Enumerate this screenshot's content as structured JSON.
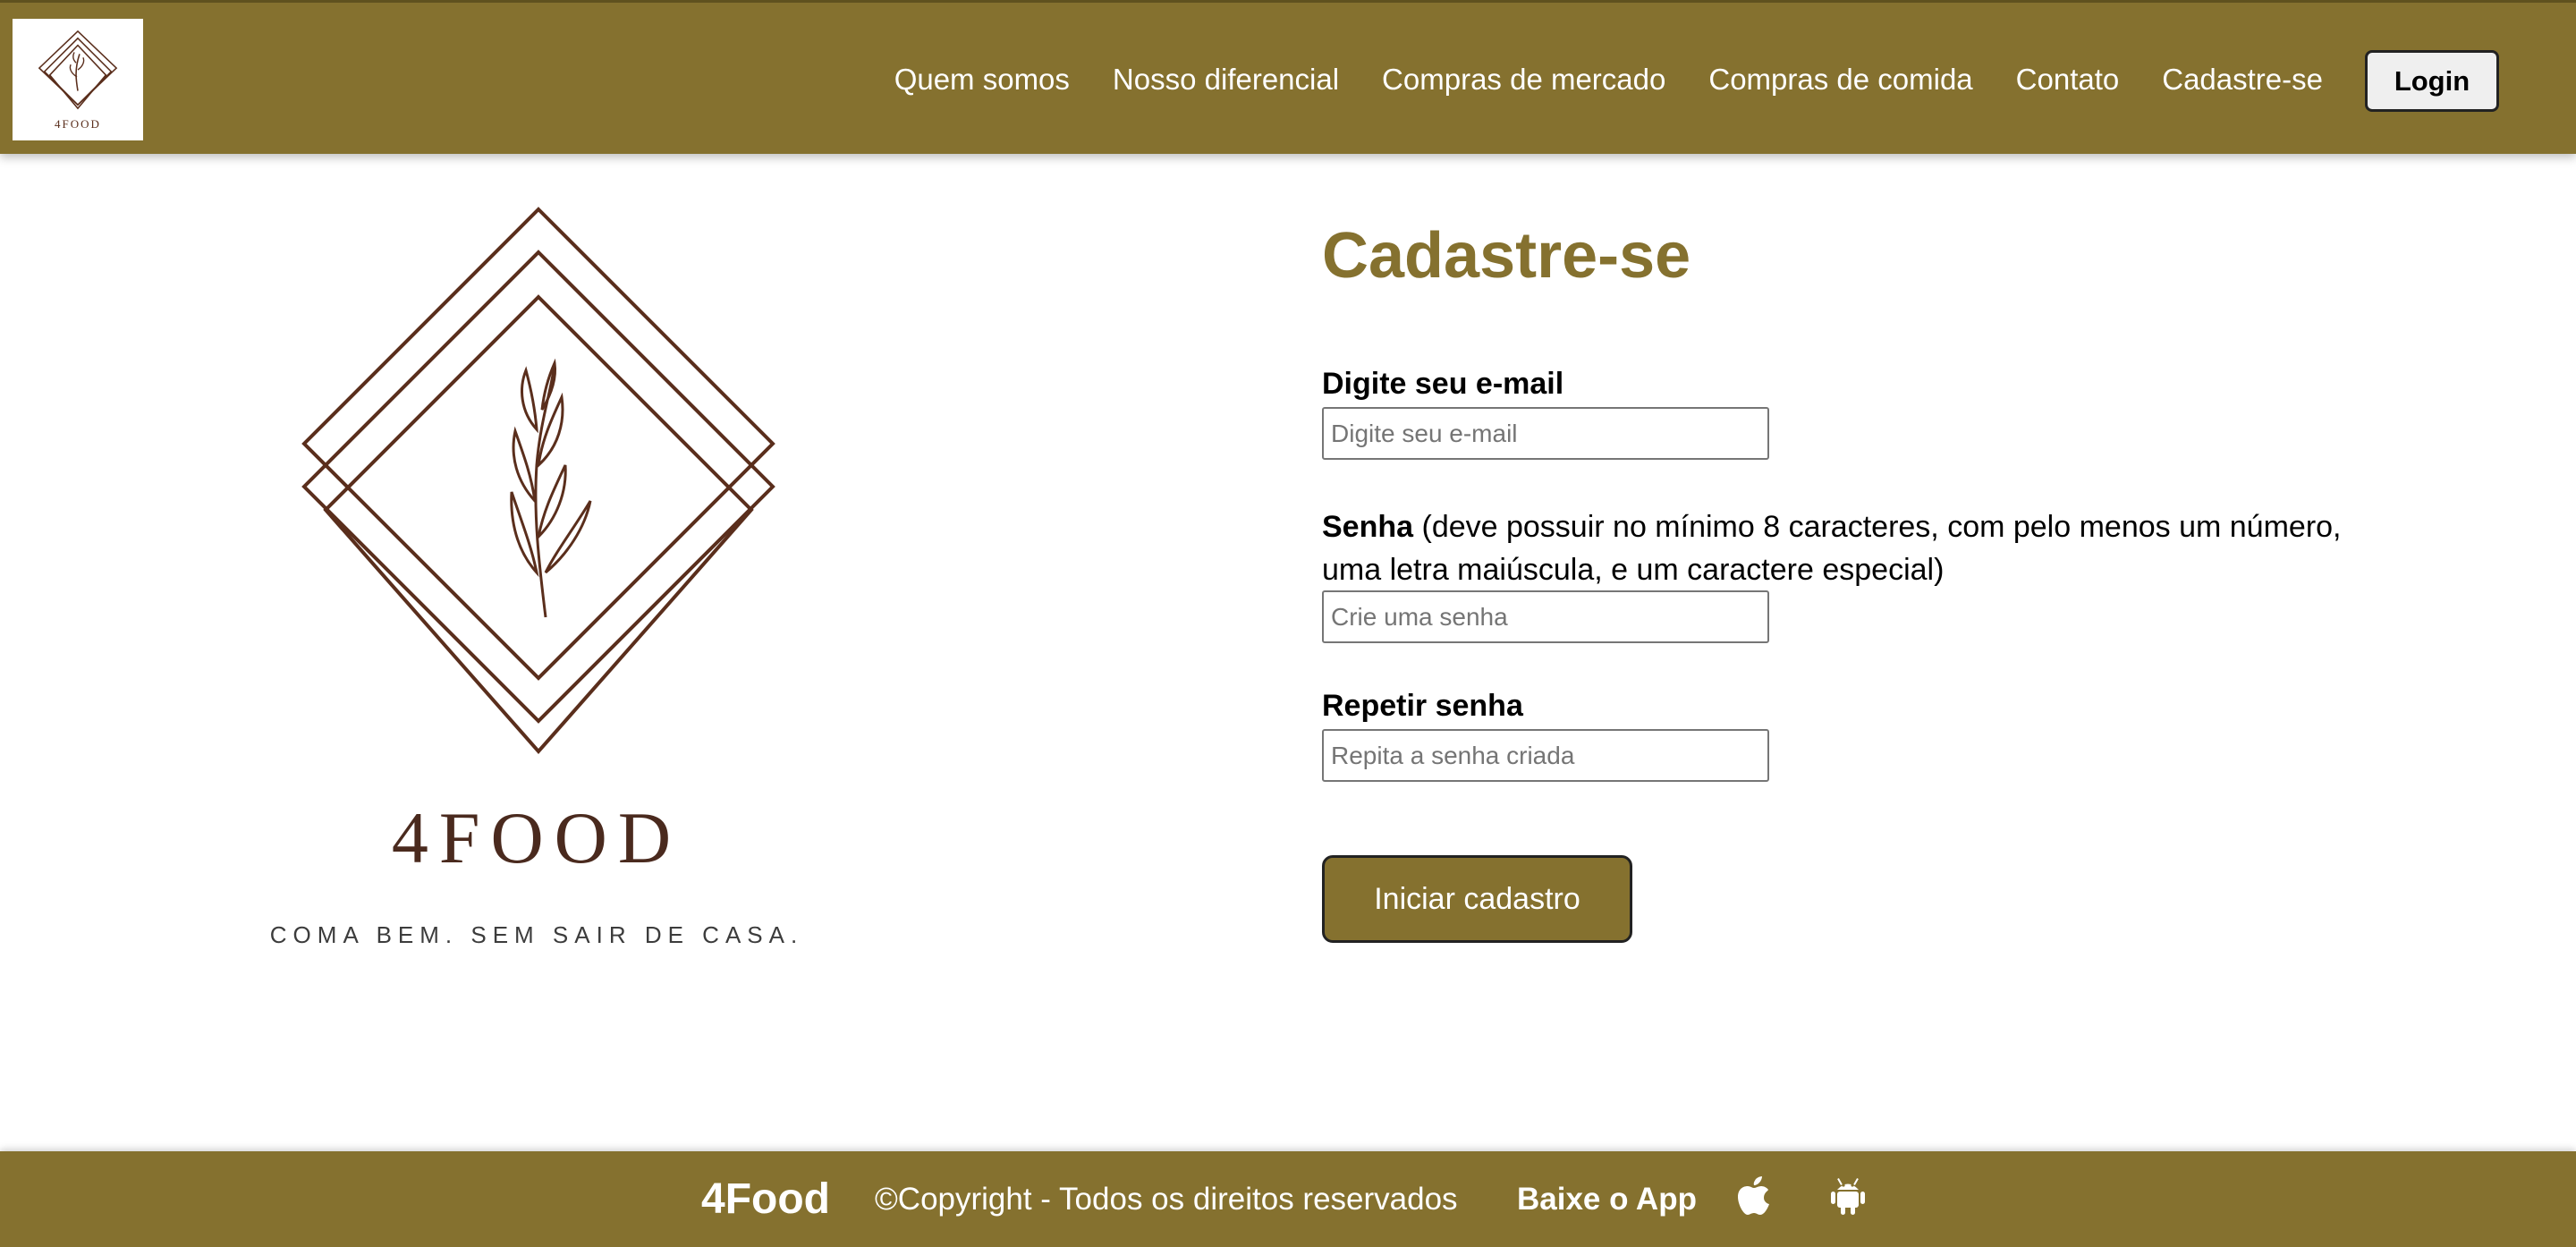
{
  "header": {
    "logo_mini_text": "4FOOD",
    "nav": [
      "Quem somos",
      "Nosso diferencial",
      "Compras de mercado",
      "Compras de comida",
      "Contato",
      "Cadastre-se"
    ],
    "login_label": "Login"
  },
  "brand": {
    "word": "4FOOD",
    "tagline": "COMA BEM. SEM SAIR DE CASA."
  },
  "form": {
    "title": "Cadastre-se",
    "email_label": "Digite seu e-mail",
    "email_placeholder": "Digite seu e-mail",
    "email_value": "",
    "password_label_bold": "Senha",
    "password_label_rest": " (deve possuir no mínimo 8 caracteres, com pelo menos um número, uma letra maiúscula, e um caractere especial)",
    "password_placeholder": "Crie uma senha",
    "password_value": "",
    "repeat_label": "Repetir senha",
    "repeat_placeholder": "Repita a senha criada",
    "repeat_value": "",
    "submit_label": "Iniciar cadastro"
  },
  "footer": {
    "brand": "4Food",
    "copyright": "©Copyright - Todos os direitos reservados",
    "app_label": "Baixe o App",
    "icons": [
      "apple-icon",
      "android-icon"
    ]
  },
  "colors": {
    "brand_olive": "#85712f",
    "logo_brown": "#5a2e1c",
    "white": "#ffffff"
  }
}
